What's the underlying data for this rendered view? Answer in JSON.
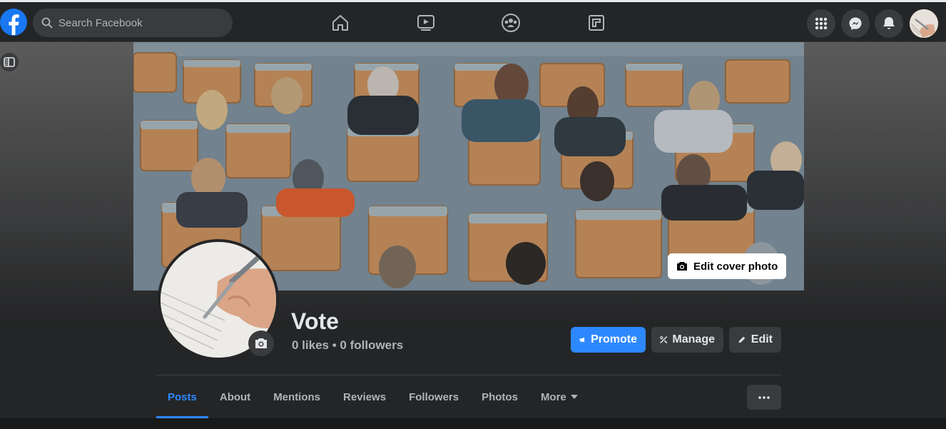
{
  "header": {
    "search_placeholder": "Search Facebook",
    "nav_icons": [
      "home-icon",
      "watch-icon",
      "groups-icon",
      "gaming-icon"
    ],
    "right_icons": [
      "menu-grid-icon",
      "messenger-icon",
      "notifications-icon"
    ]
  },
  "cover": {
    "edit_label": "Edit cover photo"
  },
  "profile": {
    "name": "Vote",
    "stats": "0 likes • 0 followers"
  },
  "actions": {
    "promote": "Promote",
    "manage": "Manage",
    "edit": "Edit"
  },
  "tabs": [
    {
      "label": "Posts",
      "active": true
    },
    {
      "label": "About"
    },
    {
      "label": "Mentions"
    },
    {
      "label": "Reviews"
    },
    {
      "label": "Followers"
    },
    {
      "label": "Photos"
    },
    {
      "label": "More"
    }
  ],
  "colors": {
    "accent": "#2d88ff",
    "background": "#18191a",
    "surface": "#242526"
  }
}
